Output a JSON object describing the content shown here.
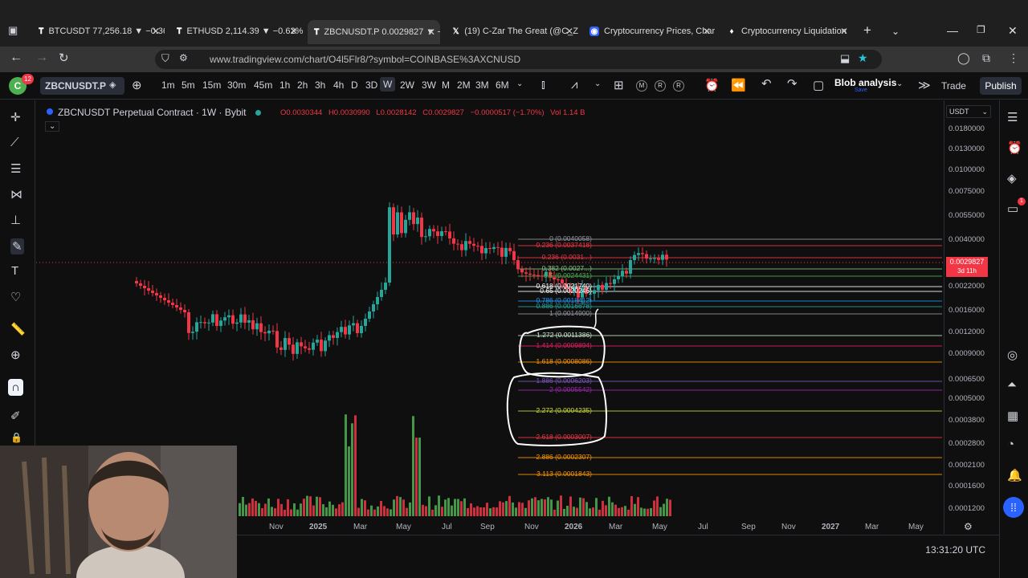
{
  "browser": {
    "tabs": [
      {
        "label": "BTCUSDT 77,256.18 ▼ −0.36",
        "icon": "tradingview-icon"
      },
      {
        "label": "ETHUSD 2,114.39 ▼ −0.62%",
        "icon": "tradingview-icon"
      },
      {
        "label": "ZBCNUSDT.P 0.0029827 ▼ −",
        "icon": "tradingview-icon",
        "active": true
      },
      {
        "label": "(19) C-Zar The Great (@C_Z",
        "icon": "x-icon"
      },
      {
        "label": "Cryptocurrency Prices, Char",
        "icon": "coinmarketcap-icon"
      },
      {
        "label": "Cryptocurrency Liquidation",
        "icon": "coinglass-icon"
      }
    ],
    "url": "www.tradingview.com/chart/O4l5Flr8/?symbol=COINBASE%3AXCNUSD"
  },
  "toolbar": {
    "symbol": "ZBCNUSDT.P",
    "timeframes": [
      "1m",
      "5m",
      "15m",
      "30m",
      "45m",
      "1h",
      "2h",
      "3h",
      "4h",
      "D",
      "3D",
      "W",
      "2W",
      "3W",
      "M",
      "2M",
      "3M",
      "6M"
    ],
    "active_timeframe": "W",
    "notification_count": "12",
    "layout_name": "Blob analysis",
    "layout_sub": "Save",
    "trade_label": "Trade",
    "publish_label": "Publish",
    "r_label": "R",
    "m_label": "M"
  },
  "legend": {
    "title": "ZBCNUSDT Perpetual Contract · 1W · Bybit",
    "open": "O0.0030344",
    "high": "H0.0030990",
    "low": "L0.0028142",
    "close": "C0.0029827",
    "change": "−0.0000517 (−1.70%)",
    "volume": "Vol 1.14 B"
  },
  "price_axis": {
    "currency": "USDT",
    "labels": [
      "0.0180000",
      "0.0130000",
      "0.0100000",
      "0.0075000",
      "0.0055000",
      "0.0040000",
      "0.0022000",
      "0.0016000",
      "0.0012000",
      "0.0009000",
      "0.0006500",
      "0.0005000",
      "0.0003800",
      "0.0002800",
      "0.0002100",
      "0.0001600",
      "0.0001200"
    ],
    "current_price": "0.0029827",
    "countdown": "3d 11h"
  },
  "time_axis": {
    "labels": [
      "Nov",
      "2025",
      "Mar",
      "May",
      "Jul",
      "Sep",
      "Nov",
      "2026",
      "Mar",
      "May",
      "Jul",
      "Sep",
      "Nov",
      "2027",
      "Mar",
      "May"
    ]
  },
  "fib_levels": [
    {
      "label": "0 (0.0040058)",
      "color": "#9598a1"
    },
    {
      "label": "0.236 (0.0037418)",
      "color": "#f23645"
    },
    {
      "label": "0.236 (0.0031...)",
      "color": "#f23645"
    },
    {
      "label": "0.382 (0.0027...)",
      "color": "#81c784"
    },
    {
      "label": "0.5 (0.0024431)",
      "color": "#4caf50"
    },
    {
      "label": "0.618 (0.0021740)",
      "color": "#ffffff"
    },
    {
      "label": "0.65 (0.0020246)",
      "color": "#ffffff"
    },
    {
      "label": "0.786 (0.0018412)",
      "color": "#2196f3"
    },
    {
      "label": "0.886 (0.0016678)",
      "color": "#26a69a"
    },
    {
      "label": "1 (0.0014900)",
      "color": "#9598a1"
    },
    {
      "label": "1.272 (0.0011386)",
      "color": "#c8e6c9"
    },
    {
      "label": "1.414 (0.0009894)",
      "color": "#e91e63"
    },
    {
      "label": "1.618 (0.0008086)",
      "color": "#ff9800"
    },
    {
      "label": "1.886 (0.0006203)",
      "color": "#7e57c2"
    },
    {
      "label": "2 (0.0005542)",
      "color": "#9c27b0"
    },
    {
      "label": "2.272 (0.0004235)",
      "color": "#cddc39"
    },
    {
      "label": "2.618 (0.0003007)",
      "color": "#f23645"
    },
    {
      "label": "2.886 (0.0002307)",
      "color": "#ff9800"
    },
    {
      "label": "3.113 (0.0001843)",
      "color": "#ff9800"
    }
  ],
  "status": {
    "clock": "13:31:20 UTC"
  },
  "colors": {
    "up": "#26a69a",
    "down": "#f23645",
    "vol_up": "#4caf50",
    "vol_down": "#f23645",
    "price_tag": "#f23645"
  }
}
